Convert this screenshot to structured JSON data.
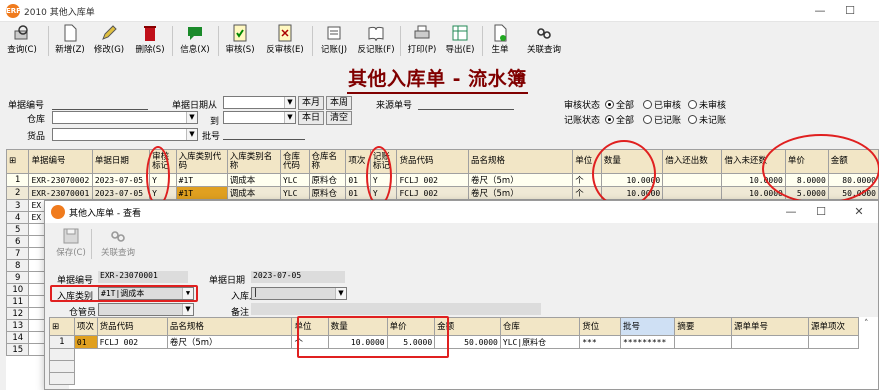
{
  "window": {
    "title": "2010 其他入库单",
    "logo": "ERP",
    "minimize": "—",
    "maximize": "☐"
  },
  "toolbar": [
    {
      "label": "查询(C)",
      "icon": "search-icon"
    },
    {
      "label": "新增(Z)",
      "icon": "new-doc-icon"
    },
    {
      "label": "修改(G)",
      "icon": "edit-icon"
    },
    {
      "label": "删除(S)",
      "icon": "delete-icon"
    },
    {
      "label": "信息(X)",
      "icon": "info-icon"
    },
    {
      "label": "审核(S)",
      "icon": "approve-icon"
    },
    {
      "label": "反审核(E)",
      "icon": "unapprove-icon"
    },
    {
      "label": "记账(J)",
      "icon": "book-icon"
    },
    {
      "label": "反记账(F)",
      "icon": "unbook-icon"
    },
    {
      "label": "打印(P)",
      "icon": "print-icon"
    },
    {
      "label": "导出(E)",
      "icon": "export-icon"
    },
    {
      "label": "生单",
      "icon": "generate-icon"
    },
    {
      "label": "关联查询",
      "icon": "link-icon"
    }
  ],
  "page_title": "其他入库单 - 流水簿",
  "filters": {
    "doc_no_label": "单据编号",
    "warehouse_label": "仓库",
    "goods_label": "货品",
    "date_from_label": "单据日期从",
    "date_to_label": "到",
    "batch_label": "批号",
    "source_no_label": "来源单号",
    "btn_month": "本月",
    "btn_week": "本周",
    "btn_day": "本日",
    "btn_clear": "清空",
    "audit_label": "审核状态",
    "audit_options": [
      "全部",
      "已审核",
      "未审核"
    ],
    "book_label": "记账状态",
    "book_options": [
      "全部",
      "已记账",
      "未记账"
    ]
  },
  "grid": {
    "columns": [
      "单据编号",
      "单据日期",
      "审核标记",
      "入库类别代码",
      "入库类别名称",
      "仓库代码",
      "仓库名称",
      "项次",
      "记账标记",
      "货品代码",
      "品名规格",
      "单位",
      "数量",
      "借入还出数",
      "借入未还数",
      "单价",
      "金额"
    ],
    "rows": [
      [
        "EXR-23070002",
        "2023-07-05",
        "Y",
        "#1T",
        "调成本",
        "YLC",
        "原料仓",
        "01",
        "Y",
        "FCLJ 002",
        "卷尺（5m）",
        "个",
        "10.0000",
        "",
        "10.0000",
        "8.0000",
        "80.0000"
      ],
      [
        "EXR-23070001",
        "2023-07-05",
        "Y",
        "#1T",
        "调成本",
        "YLC",
        "原料仓",
        "01",
        "Y",
        "FCLJ 002",
        "卷尺（5m）",
        "个",
        "10.0000",
        "",
        "10.0000",
        "5.0000",
        "50.0000"
      ],
      [
        "EX",
        "",
        "",
        "",
        "",
        "",
        "",
        "",
        "",
        "",
        "",
        "",
        "",
        "",
        "",
        "",
        ""
      ],
      [
        "EX",
        "",
        "",
        "",
        "",
        "",
        "",
        "",
        "",
        "",
        "",
        "",
        "",
        "",
        "",
        "",
        ""
      ]
    ],
    "row_numbers": [
      "1",
      "2",
      "3",
      "4",
      "5",
      "6",
      "7",
      "8",
      "9",
      "10",
      "11",
      "12",
      "13",
      "14",
      "15"
    ]
  },
  "dialog": {
    "title": "其他入库单 - 查看",
    "save_label": "保存(C)",
    "link_label": "关联查询",
    "doc_no_label": "单据编号",
    "doc_no": "EXR-23070001",
    "date_label": "单据日期",
    "date": "2023-07-05",
    "type_label": "入库类别",
    "type": "#1T|调成本",
    "receiver_label": "入库人",
    "receiver": "|",
    "warehouse_keeper_label": "仓管员",
    "remark_label": "备注",
    "columns": [
      "项次",
      "货品代码",
      "品名规格",
      "单位",
      "数量",
      "单价",
      "金额",
      "仓库",
      "货位",
      "批号",
      "摘要",
      "源单单号",
      "源单项次"
    ],
    "row": [
      "01",
      "FCLJ 002",
      "卷尺（5m）",
      "个",
      "10.0000",
      "5.0000",
      "50.0000",
      "YLC|原料仓",
      "***",
      "*********",
      "",
      "",
      ""
    ],
    "row_number": "1"
  }
}
